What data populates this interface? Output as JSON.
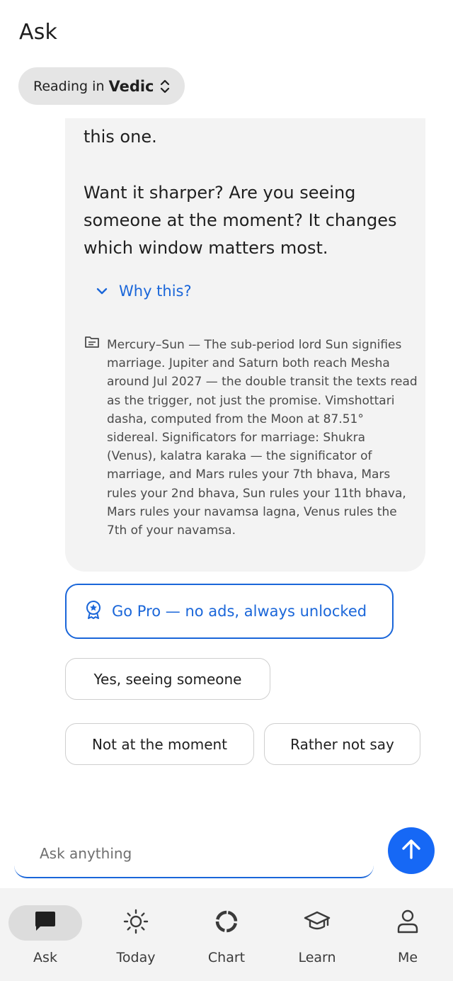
{
  "header": {
    "title": "Ask"
  },
  "mode": {
    "prefix": "Reading in",
    "value": "Vedic"
  },
  "message": {
    "line1": "this one.",
    "line2": "Want it sharper? Are you seeing someone at the moment? It changes which window matters most.",
    "why_label": "Why this?",
    "source_text": "Mercury–Sun — The sub-period lord Sun signifies marriage. Jupiter and Saturn both reach Mesha around Jul 2027 — the double transit the texts read as the trigger, not just the promise. Vimshottari dasha, computed from the Moon at 87.51° sidereal. Significators for marriage: Shukra (Venus), kalatra karaka — the significator of marriage, and Mars rules your 7th bhava, Mars rules your 2nd bhava, Sun rules your 11th bhava, Mars rules your navamsa lagna, Venus rules the 7th of your navamsa."
  },
  "pro": {
    "label": "Go Pro — no ads, always unlocked"
  },
  "replies": [
    "Yes, seeing someone",
    "Not at the moment",
    "Rather not say"
  ],
  "input": {
    "placeholder": "Ask anything"
  },
  "nav": {
    "items": [
      {
        "label": "Ask",
        "icon": "chat-icon",
        "active": true
      },
      {
        "label": "Today",
        "icon": "sun-icon",
        "active": false
      },
      {
        "label": "Chart",
        "icon": "chart-ring-icon",
        "active": false
      },
      {
        "label": "Learn",
        "icon": "graduation-cap-icon",
        "active": false
      },
      {
        "label": "Me",
        "icon": "person-icon",
        "active": false
      }
    ]
  },
  "colors": {
    "accent": "#1a66d9",
    "send": "#1668f5",
    "bubble": "#f3f3f3",
    "nav_bg": "#f3f3f3"
  }
}
